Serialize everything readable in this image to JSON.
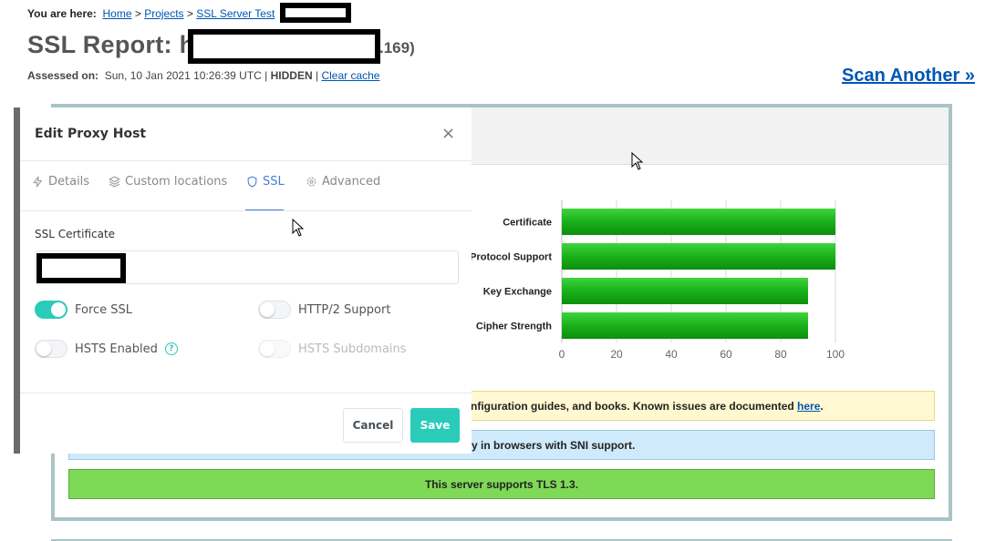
{
  "breadcrumb": {
    "prefix": "You are here:",
    "home": "Home",
    "projects": "Projects",
    "ssl_server_test": "SSL Server Test",
    "sep": ">"
  },
  "report": {
    "title_prefix": "SSL Report: h",
    "title_suffix": ".169)",
    "assessed_label": "Assessed on:",
    "assessed_value": "Sun, 10 Jan 2021 10:26:39 UTC",
    "hidden_label": "HIDDEN",
    "clear_cache": "Clear cache",
    "scan_another": "Scan Another »"
  },
  "chart_data": {
    "type": "bar",
    "orientation": "horizontal",
    "categories": [
      "Certificate",
      "Protocol Support",
      "Key Exchange",
      "Cipher Strength"
    ],
    "values": [
      100,
      100,
      90,
      90
    ],
    "xticks": [
      0,
      20,
      40,
      60,
      80,
      100
    ],
    "xlim": [
      0,
      100
    ],
    "grid": true,
    "bar_color": "#19b019"
  },
  "banners": {
    "yellow_text": "nfiguration guides, and books. Known issues are documented ",
    "yellow_link": "here",
    "yellow_end": ".",
    "blue_text": "y in browsers with SNI support.",
    "green_text": "This server supports TLS 1.3."
  },
  "modal": {
    "title": "Edit Proxy Host",
    "close": "×",
    "tabs": [
      {
        "label": "Details",
        "icon": "bolt-icon"
      },
      {
        "label": "Custom locations",
        "icon": "layers-icon"
      },
      {
        "label": "SSL",
        "icon": "shield-icon"
      },
      {
        "label": "Advanced",
        "icon": "gear-icon"
      }
    ],
    "active_tab": "SSL",
    "ssl_certificate_label": "SSL Certificate",
    "toggles": {
      "force_ssl": {
        "label": "Force SSL",
        "on": true
      },
      "http2": {
        "label": "HTTP/2 Support",
        "on": false
      },
      "hsts": {
        "label": "HSTS Enabled",
        "on": false
      },
      "hsts_sub": {
        "label": "HSTS Subdomains",
        "on": false,
        "disabled": true
      }
    },
    "help_icon": "?",
    "cancel": "Cancel",
    "save": "Save"
  },
  "colors": {
    "accent_teal": "#2bcbba",
    "tab_active": "#467fcf",
    "link": "#0056b3",
    "report_border": "#a9c4c4"
  }
}
